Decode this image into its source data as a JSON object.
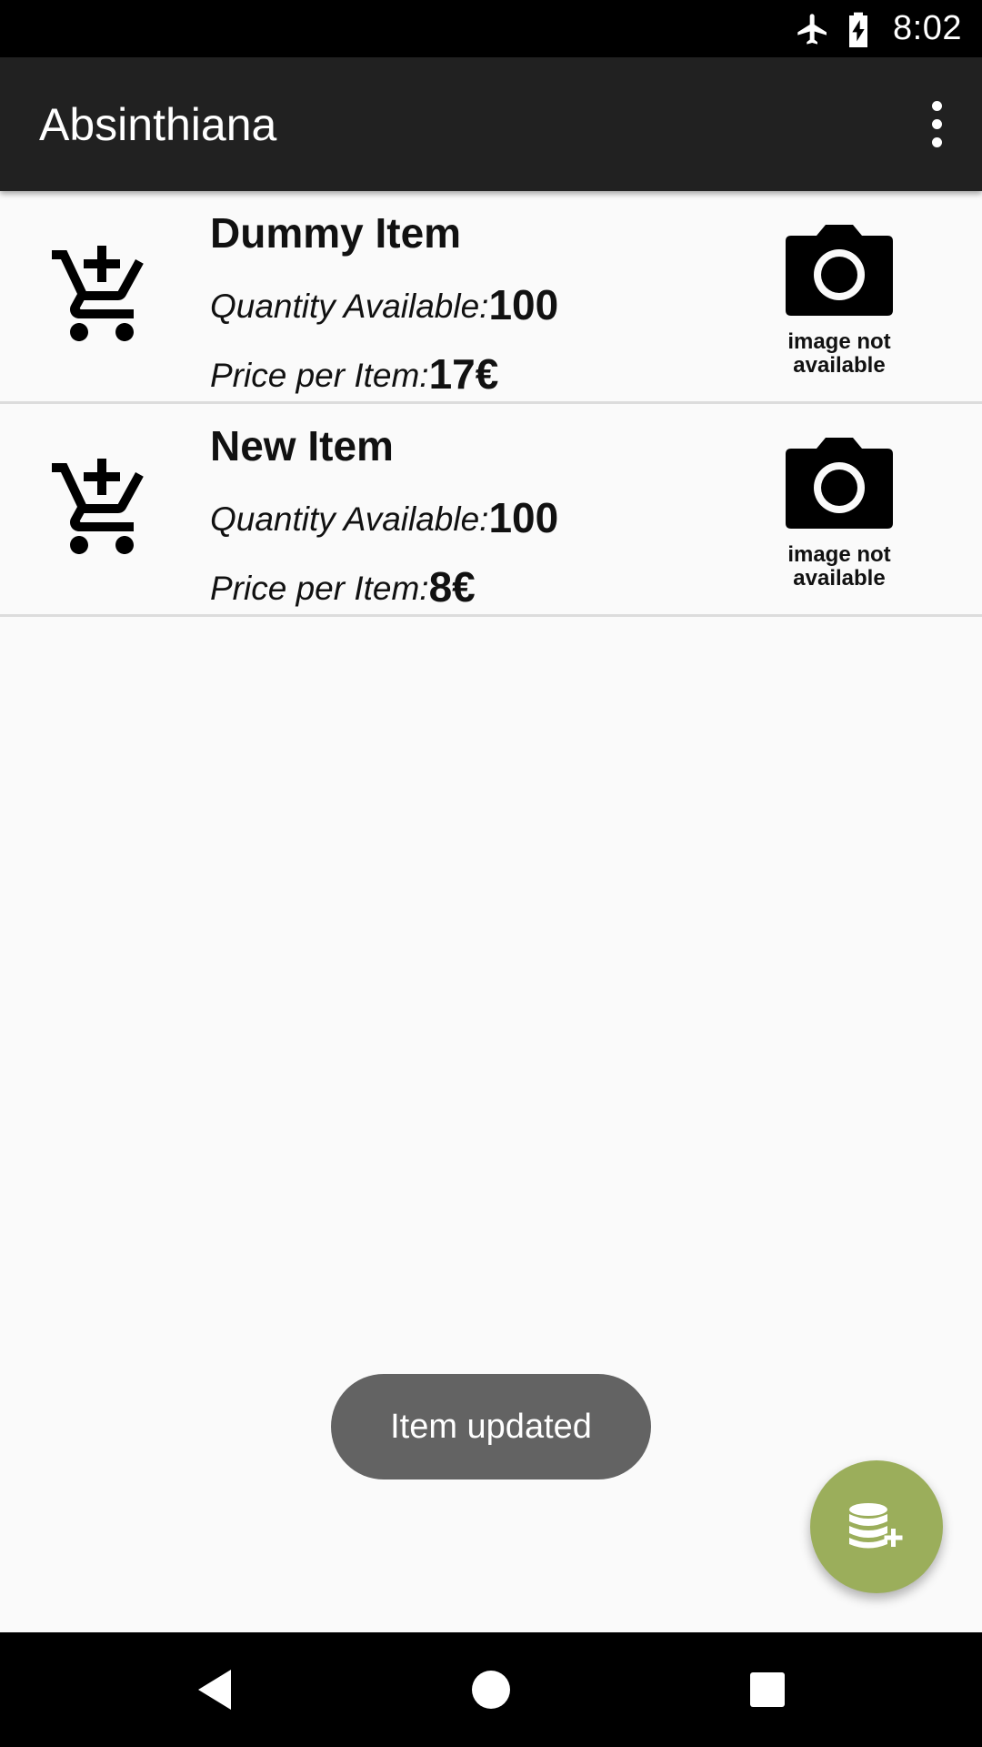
{
  "status_bar": {
    "time": "8:02",
    "icons": [
      "airplane-mode-icon",
      "battery-charging-icon"
    ]
  },
  "app_bar": {
    "title": "Absinthiana",
    "menu_icon": "more-vert-icon"
  },
  "items": [
    {
      "name": "Dummy Item",
      "quantity_label": "Quantity Available:",
      "quantity": "100",
      "price_label": "Price per Item:",
      "price": "17€",
      "image_caption_line1": "image not",
      "image_caption_line2": "available"
    },
    {
      "name": "New Item",
      "quantity_label": "Quantity Available:",
      "quantity": "100",
      "price_label": "Price per Item:",
      "price": "8€",
      "image_caption_line1": "image not",
      "image_caption_line2": "available"
    }
  ],
  "toast": {
    "message": "Item updated"
  },
  "fab": {
    "icon": "database-add-icon",
    "color": "#9bae5b"
  },
  "nav_bar": {
    "icons": [
      "back-icon",
      "home-icon",
      "recents-icon"
    ]
  }
}
